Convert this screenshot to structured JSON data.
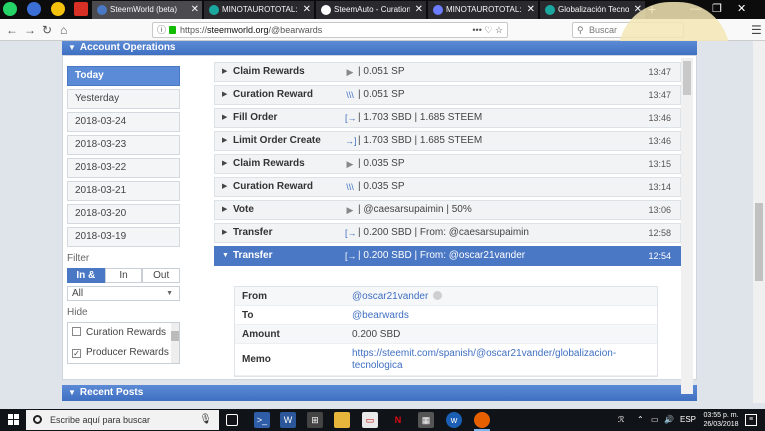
{
  "browser": {
    "tabs": [
      {
        "title": "SteemWorld (beta)",
        "active": true,
        "favicon_color": "#4a78c4"
      },
      {
        "title": "MINOTAUROTOTAL: TOTA",
        "active": false,
        "favicon_color": "#1aa79f"
      },
      {
        "title": "SteemAuto - Curation Tra",
        "active": false,
        "favicon_color": "#ffffff"
      },
      {
        "title": "MINOTAUROTOTAL: TOTA",
        "active": false,
        "favicon_color": "#6b7cff"
      },
      {
        "title": "Globalización Tecnológica",
        "active": false,
        "favicon_color": "#1aa79f"
      }
    ],
    "url_prefix": "https://",
    "url_host": "steemworld.org",
    "url_path": "/@bearwards",
    "url_tools": "••• ♡ ☆",
    "search_placeholder": "Buscar"
  },
  "account_ops": {
    "title": "Account Operations",
    "days": [
      "Today",
      "Yesterday",
      "2018-03-24",
      "2018-03-23",
      "2018-03-22",
      "2018-03-21",
      "2018-03-20",
      "2018-03-19"
    ],
    "active_day_index": 0,
    "filter_label": "Filter",
    "filter_options": [
      "In & Out",
      "In",
      "Out"
    ],
    "filter_active_index": 0,
    "select_value": "All",
    "hide_label": "Hide",
    "hide_items": [
      {
        "label": "Curation Rewards",
        "checked": false
      },
      {
        "label": "Producer Rewards",
        "checked": true
      }
    ],
    "operations": [
      {
        "name": "Claim Rewards",
        "icon": "play-icon",
        "icon_glyph": "▶",
        "detail": "| 0.051 SP",
        "time": "13:47"
      },
      {
        "name": "Curation Reward",
        "icon": "curation-icon",
        "icon_glyph": "\\\\\\",
        "detail": "| 0.051 SP",
        "time": "13:47"
      },
      {
        "name": "Fill Order",
        "icon": "order-icon",
        "icon_glyph": "[→",
        "detail": "| 1.703 SBD | 1.685 STEEM",
        "time": "13:46"
      },
      {
        "name": "Limit Order Create",
        "icon": "order-create-icon",
        "icon_glyph": "→]",
        "detail": "| 1.703 SBD | 1.685 STEEM",
        "time": "13:46"
      },
      {
        "name": "Claim Rewards",
        "icon": "play-icon",
        "icon_glyph": "▶",
        "detail": "| 0.035 SP",
        "time": "13:15"
      },
      {
        "name": "Curation Reward",
        "icon": "curation-icon",
        "icon_glyph": "\\\\\\",
        "detail": "| 0.035 SP",
        "time": "13:14"
      },
      {
        "name": "Vote",
        "icon": "play-icon",
        "icon_glyph": "▶",
        "detail": "| @caesarsupaimin | 50%",
        "time": "13:06"
      },
      {
        "name": "Transfer",
        "icon": "transfer-in-icon",
        "icon_glyph": "[→",
        "detail": "| 0.200 SBD | From: @caesarsupaimin",
        "time": "12:58"
      },
      {
        "name": "Transfer",
        "icon": "transfer-in-icon",
        "icon_glyph": "[→",
        "detail": "| 0.200 SBD | From: @oscar21vander",
        "time": "12:54",
        "expanded": true
      }
    ],
    "transfer_details": [
      {
        "key": "From",
        "value": "@oscar21vander",
        "link": true
      },
      {
        "key": "To",
        "value": "@bearwards",
        "link": true
      },
      {
        "key": "Amount",
        "value": "0.200 SBD",
        "link": false
      },
      {
        "key": "Memo",
        "value": "https://steemit.com/spanish/@oscar21vander/globalizacion-tecnologica",
        "link": true
      }
    ]
  },
  "recent_posts": {
    "title": "Recent Posts"
  },
  "taskbar": {
    "search_placeholder": "Escribe aquí para buscar",
    "tray_lang": "ESP",
    "time": "03:55 p. m.",
    "date": "26/03/2018"
  },
  "colors": {
    "accent": "#4a78c4",
    "header_gradient_top": "#5b8ad6",
    "link": "#3f6fc1"
  }
}
